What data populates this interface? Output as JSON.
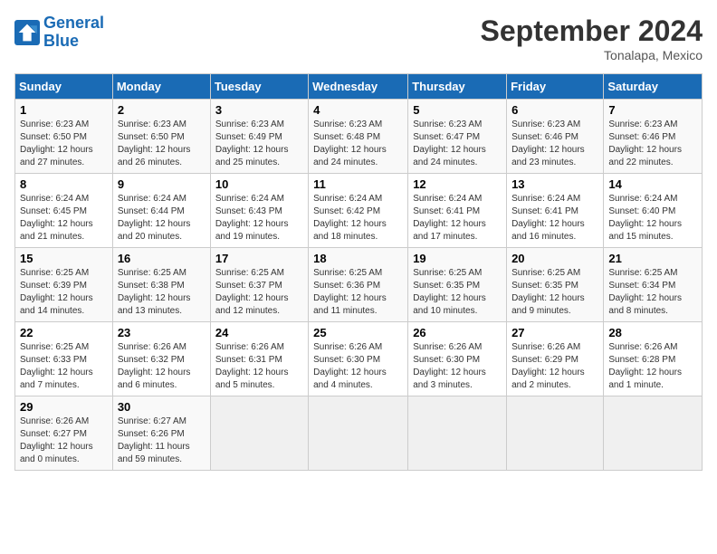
{
  "logo": {
    "line1": "General",
    "line2": "Blue"
  },
  "title": "September 2024",
  "subtitle": "Tonalapa, Mexico",
  "headers": [
    "Sunday",
    "Monday",
    "Tuesday",
    "Wednesday",
    "Thursday",
    "Friday",
    "Saturday"
  ],
  "weeks": [
    [
      {
        "day": "1",
        "info": "Sunrise: 6:23 AM\nSunset: 6:50 PM\nDaylight: 12 hours\nand 27 minutes."
      },
      {
        "day": "2",
        "info": "Sunrise: 6:23 AM\nSunset: 6:50 PM\nDaylight: 12 hours\nand 26 minutes."
      },
      {
        "day": "3",
        "info": "Sunrise: 6:23 AM\nSunset: 6:49 PM\nDaylight: 12 hours\nand 25 minutes."
      },
      {
        "day": "4",
        "info": "Sunrise: 6:23 AM\nSunset: 6:48 PM\nDaylight: 12 hours\nand 24 minutes."
      },
      {
        "day": "5",
        "info": "Sunrise: 6:23 AM\nSunset: 6:47 PM\nDaylight: 12 hours\nand 24 minutes."
      },
      {
        "day": "6",
        "info": "Sunrise: 6:23 AM\nSunset: 6:46 PM\nDaylight: 12 hours\nand 23 minutes."
      },
      {
        "day": "7",
        "info": "Sunrise: 6:23 AM\nSunset: 6:46 PM\nDaylight: 12 hours\nand 22 minutes."
      }
    ],
    [
      {
        "day": "8",
        "info": "Sunrise: 6:24 AM\nSunset: 6:45 PM\nDaylight: 12 hours\nand 21 minutes."
      },
      {
        "day": "9",
        "info": "Sunrise: 6:24 AM\nSunset: 6:44 PM\nDaylight: 12 hours\nand 20 minutes."
      },
      {
        "day": "10",
        "info": "Sunrise: 6:24 AM\nSunset: 6:43 PM\nDaylight: 12 hours\nand 19 minutes."
      },
      {
        "day": "11",
        "info": "Sunrise: 6:24 AM\nSunset: 6:42 PM\nDaylight: 12 hours\nand 18 minutes."
      },
      {
        "day": "12",
        "info": "Sunrise: 6:24 AM\nSunset: 6:41 PM\nDaylight: 12 hours\nand 17 minutes."
      },
      {
        "day": "13",
        "info": "Sunrise: 6:24 AM\nSunset: 6:41 PM\nDaylight: 12 hours\nand 16 minutes."
      },
      {
        "day": "14",
        "info": "Sunrise: 6:24 AM\nSunset: 6:40 PM\nDaylight: 12 hours\nand 15 minutes."
      }
    ],
    [
      {
        "day": "15",
        "info": "Sunrise: 6:25 AM\nSunset: 6:39 PM\nDaylight: 12 hours\nand 14 minutes."
      },
      {
        "day": "16",
        "info": "Sunrise: 6:25 AM\nSunset: 6:38 PM\nDaylight: 12 hours\nand 13 minutes."
      },
      {
        "day": "17",
        "info": "Sunrise: 6:25 AM\nSunset: 6:37 PM\nDaylight: 12 hours\nand 12 minutes."
      },
      {
        "day": "18",
        "info": "Sunrise: 6:25 AM\nSunset: 6:36 PM\nDaylight: 12 hours\nand 11 minutes."
      },
      {
        "day": "19",
        "info": "Sunrise: 6:25 AM\nSunset: 6:35 PM\nDaylight: 12 hours\nand 10 minutes."
      },
      {
        "day": "20",
        "info": "Sunrise: 6:25 AM\nSunset: 6:35 PM\nDaylight: 12 hours\nand 9 minutes."
      },
      {
        "day": "21",
        "info": "Sunrise: 6:25 AM\nSunset: 6:34 PM\nDaylight: 12 hours\nand 8 minutes."
      }
    ],
    [
      {
        "day": "22",
        "info": "Sunrise: 6:25 AM\nSunset: 6:33 PM\nDaylight: 12 hours\nand 7 minutes."
      },
      {
        "day": "23",
        "info": "Sunrise: 6:26 AM\nSunset: 6:32 PM\nDaylight: 12 hours\nand 6 minutes."
      },
      {
        "day": "24",
        "info": "Sunrise: 6:26 AM\nSunset: 6:31 PM\nDaylight: 12 hours\nand 5 minutes."
      },
      {
        "day": "25",
        "info": "Sunrise: 6:26 AM\nSunset: 6:30 PM\nDaylight: 12 hours\nand 4 minutes."
      },
      {
        "day": "26",
        "info": "Sunrise: 6:26 AM\nSunset: 6:30 PM\nDaylight: 12 hours\nand 3 minutes."
      },
      {
        "day": "27",
        "info": "Sunrise: 6:26 AM\nSunset: 6:29 PM\nDaylight: 12 hours\nand 2 minutes."
      },
      {
        "day": "28",
        "info": "Sunrise: 6:26 AM\nSunset: 6:28 PM\nDaylight: 12 hours\nand 1 minute."
      }
    ],
    [
      {
        "day": "29",
        "info": "Sunrise: 6:26 AM\nSunset: 6:27 PM\nDaylight: 12 hours\nand 0 minutes."
      },
      {
        "day": "30",
        "info": "Sunrise: 6:27 AM\nSunset: 6:26 PM\nDaylight: 11 hours\nand 59 minutes."
      },
      {
        "day": "",
        "info": ""
      },
      {
        "day": "",
        "info": ""
      },
      {
        "day": "",
        "info": ""
      },
      {
        "day": "",
        "info": ""
      },
      {
        "day": "",
        "info": ""
      }
    ]
  ]
}
